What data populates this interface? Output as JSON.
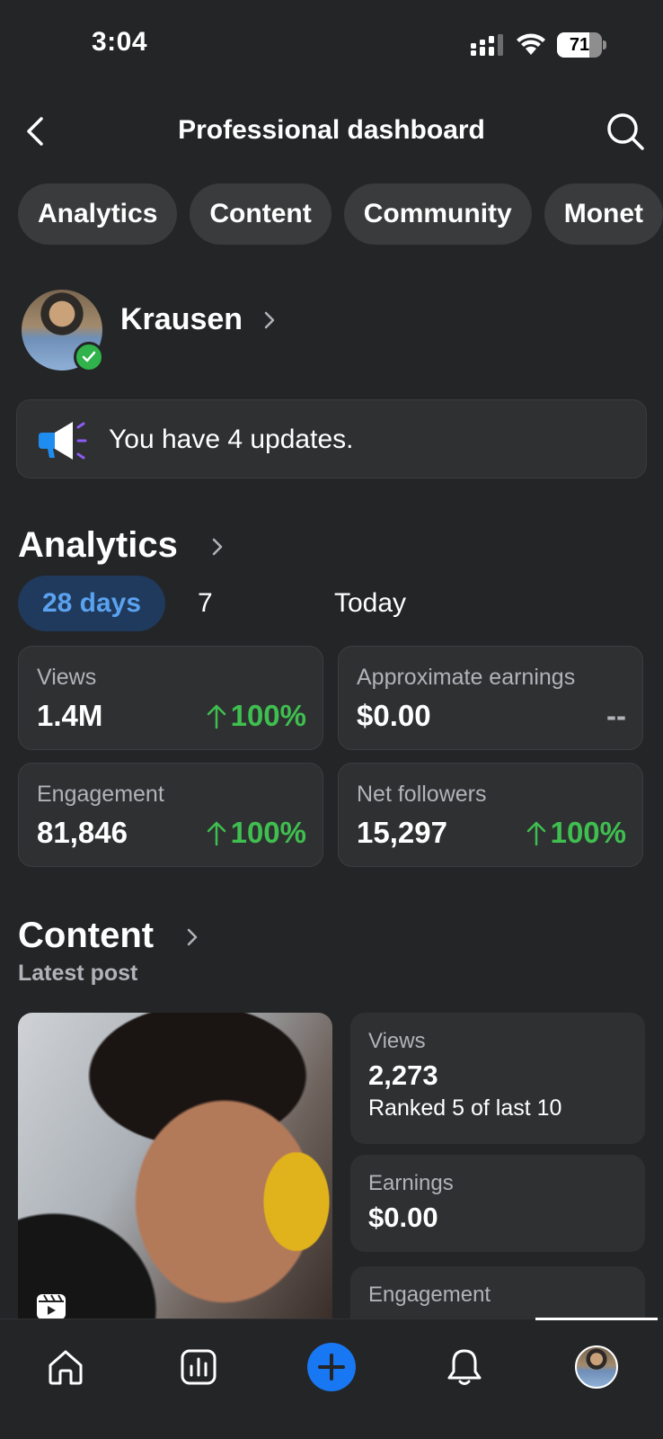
{
  "status_bar": {
    "time": "3:04",
    "battery": "71",
    "battery_level": 0.71
  },
  "header": {
    "title": "Professional dashboard"
  },
  "tabs": [
    {
      "label": "Analytics"
    },
    {
      "label": "Content"
    },
    {
      "label": "Community"
    },
    {
      "label": "Monet"
    }
  ],
  "profile": {
    "name": "Krausen"
  },
  "updates": {
    "text": "You have 4 updates."
  },
  "analytics": {
    "title": "Analytics",
    "ranges": [
      "28 days",
      "7 days",
      "Today"
    ],
    "selected_range": "28 days",
    "stats": [
      {
        "label": "Views",
        "value": "1.4M",
        "change": "100%"
      },
      {
        "label": "Approximate earnings",
        "value": "$0.00",
        "change": "--"
      },
      {
        "label": "Engagement",
        "value": "81,846",
        "change": "100%"
      },
      {
        "label": "Net followers",
        "value": "15,297",
        "change": "100%"
      }
    ]
  },
  "content": {
    "title": "Content",
    "subheading": "Latest post",
    "views_label": "Views",
    "views_value": "2,273",
    "views_rank": "Ranked 5 of last 10",
    "earnings_label": "Earnings",
    "earnings_value": "$0.00",
    "engagement_label": "Engagement"
  },
  "icons": {
    "back": "back-arrow-icon",
    "search": "search-icon",
    "megaphone": "megaphone-icon",
    "reel": "reel-icon",
    "nav": [
      "home-icon",
      "insights-icon",
      "create-icon",
      "notifications-icon",
      "profile-avatar"
    ]
  },
  "colors": {
    "background": "#242527",
    "card": "#2f3032",
    "accent_blue": "#1877f2",
    "positive_green": "#3fbf4f",
    "muted_text": "#b0b3b8",
    "range_active_bg": "#1f3a5c",
    "range_active_text": "#5aa2f0"
  }
}
